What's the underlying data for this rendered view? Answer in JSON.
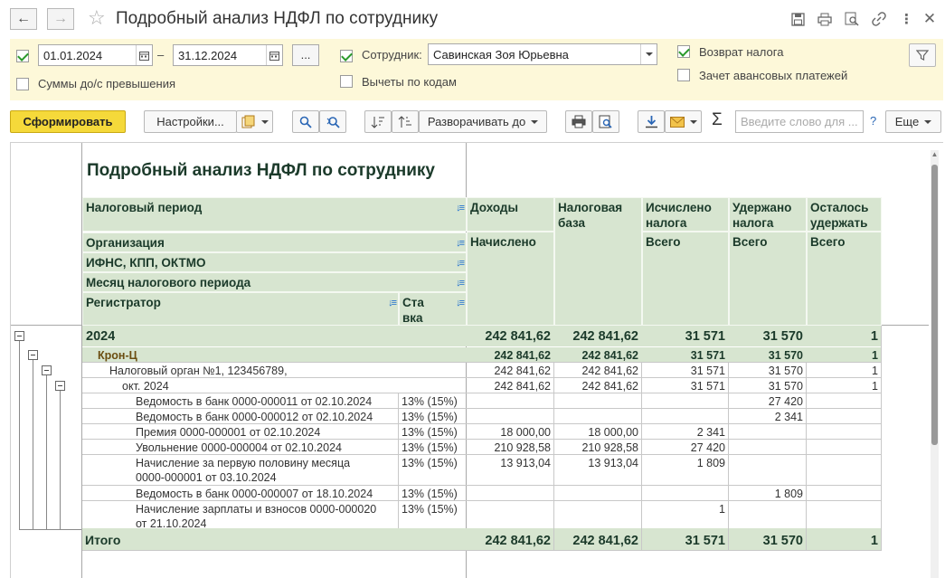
{
  "window": {
    "title": "Подробный анализ НДФЛ по сотруднику"
  },
  "filters": {
    "period_enabled": true,
    "date_from": "01.01.2024",
    "date_sep": "–",
    "date_to": "31.12.2024",
    "more_label": "...",
    "sums_label": "Суммы до/с превышения",
    "employee_enabled": true,
    "employee_label": "Сотрудник:",
    "employee_value": "Савинская Зоя Юрьевна",
    "deductions_label": "Вычеты по кодам",
    "refund_enabled": true,
    "refund_label": "Возврат налога",
    "offset_label": "Зачет авансовых платежей"
  },
  "toolbar": {
    "generate_label": "Сформировать",
    "settings_label": "Настройки...",
    "expand_label": "Разворачивать до",
    "sum_symbol": "Σ",
    "search_placeholder": "Введите слово для ...",
    "help_label": "?",
    "more_label": "Еще"
  },
  "report": {
    "title": "Подробный анализ НДФЛ по сотруднику",
    "headers": {
      "period": "Налоговый период",
      "org": "Организация",
      "ifns": "ИФНС, КПП, ОКТМО",
      "month": "Месяц налогового периода",
      "registrar": "Регистратор",
      "rate": "Ставка",
      "income": "Доходы",
      "accrued": "Начислено",
      "taxbase": "Налоговая база",
      "calculated": "Исчислено налога",
      "withheld": "Удержано налога",
      "remaining": "Осталось удержать",
      "total_calc": "Всего",
      "total_withheld": "Всего",
      "total_remaining": "Всего"
    },
    "groups": [
      {
        "label": "2024",
        "income": "242 841,62",
        "base": "242 841,62",
        "calc": "31 571",
        "withheld": "31 570",
        "remain": "1"
      },
      {
        "label": "Крон-Ц",
        "income": "242 841,62",
        "base": "242 841,62",
        "calc": "31 571",
        "withheld": "31 570",
        "remain": "1"
      },
      {
        "label": "Налоговый орган №1, 123456789,",
        "income": "242 841,62",
        "base": "242 841,62",
        "calc": "31 571",
        "withheld": "31 570",
        "remain": "1"
      },
      {
        "label": "окт. 2024",
        "income": "242 841,62",
        "base": "242 841,62",
        "calc": "31 571",
        "withheld": "31 570",
        "remain": "1"
      }
    ],
    "rows": [
      {
        "registrar": "Ведомость в банк 0000-000011 от 02.10.2024",
        "rate": "13% (15%)",
        "income": "",
        "base": "",
        "calc": "",
        "withheld": "27 420",
        "remain": ""
      },
      {
        "registrar": "Ведомость в банк 0000-000012 от 02.10.2024",
        "rate": "13% (15%)",
        "income": "",
        "base": "",
        "calc": "",
        "withheld": "2 341",
        "remain": ""
      },
      {
        "registrar": "Премия 0000-000001 от 02.10.2024",
        "rate": "13% (15%)",
        "income": "18 000,00",
        "base": "18 000,00",
        "calc": "2 341",
        "withheld": "",
        "remain": ""
      },
      {
        "registrar": "Увольнение 0000-000004 от 02.10.2024",
        "rate": "13% (15%)",
        "income": "210 928,58",
        "base": "210 928,58",
        "calc": "27 420",
        "withheld": "",
        "remain": ""
      },
      {
        "registrar": "Начисление за первую половину месяца",
        "registrar2": "0000-000001 от 03.10.2024",
        "rate": "13% (15%)",
        "income": "13 913,04",
        "base": "13 913,04",
        "calc": "1 809",
        "withheld": "",
        "remain": ""
      },
      {
        "registrar": "Ведомость в банк 0000-000007 от 18.10.2024",
        "rate": "13% (15%)",
        "income": "",
        "base": "",
        "calc": "",
        "withheld": "1 809",
        "remain": ""
      },
      {
        "registrar": "Начисление зарплаты и взносов 0000-000020",
        "registrar2": "от 21.10.2024",
        "rate": "13% (15%)",
        "income": "",
        "base": "",
        "calc": "1",
        "withheld": "",
        "remain": ""
      }
    ],
    "total": {
      "label": "Итого",
      "income": "242 841,62",
      "base": "242 841,62",
      "calc": "31 571",
      "withheld": "31 570",
      "remain": "1"
    }
  }
}
